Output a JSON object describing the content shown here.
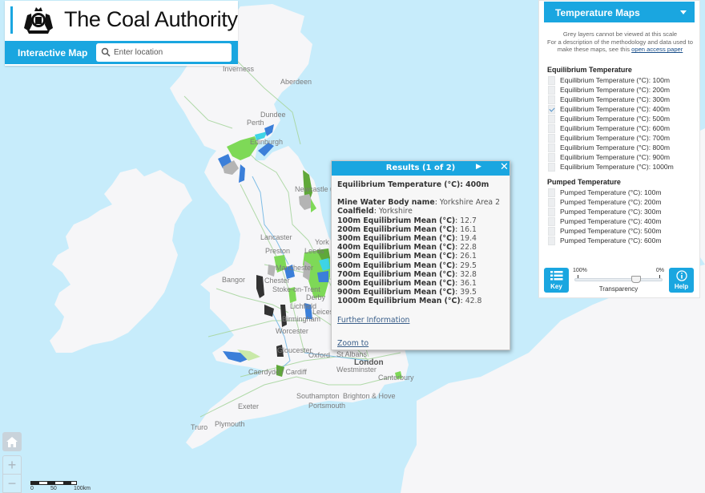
{
  "header": {
    "title": "The Coal Authority",
    "subtitle": "Interactive Map",
    "search_placeholder": "Enter location",
    "search_value": ""
  },
  "map": {
    "places": [
      {
        "name": "Inverness",
        "kind": "minor"
      },
      {
        "name": "Aberdeen",
        "kind": "minor"
      },
      {
        "name": "Dundee",
        "kind": "minor"
      },
      {
        "name": "Perth",
        "kind": "minor"
      },
      {
        "name": "Edinburgh",
        "kind": "minor"
      },
      {
        "name": "Newcastle upon Tyne",
        "kind": "minor"
      },
      {
        "name": "Lancaster",
        "kind": "minor"
      },
      {
        "name": "Preston",
        "kind": "minor"
      },
      {
        "name": "York",
        "kind": "minor"
      },
      {
        "name": "Leeds",
        "kind": "minor"
      },
      {
        "name": "Manchester",
        "kind": "minor"
      },
      {
        "name": "Bangor",
        "kind": "minor"
      },
      {
        "name": "Chester",
        "kind": "minor"
      },
      {
        "name": "Stoke-on-Trent",
        "kind": "minor"
      },
      {
        "name": "Derby",
        "kind": "minor"
      },
      {
        "name": "Lichfield",
        "kind": "minor"
      },
      {
        "name": "Leicester",
        "kind": "minor"
      },
      {
        "name": "Birmingham",
        "kind": "minor"
      },
      {
        "name": "Worcester",
        "kind": "minor"
      },
      {
        "name": "Gloucester",
        "kind": "minor"
      },
      {
        "name": "Oxford",
        "kind": "minor"
      },
      {
        "name": "St Albans",
        "kind": "minor"
      },
      {
        "name": "London",
        "kind": "major"
      },
      {
        "name": "Westminster",
        "kind": "minor"
      },
      {
        "name": "Canterbury",
        "kind": "minor"
      },
      {
        "name": "Caerdydd / Cardiff",
        "kind": "minor"
      },
      {
        "name": "Southampton",
        "kind": "minor"
      },
      {
        "name": "Portsmouth",
        "kind": "minor"
      },
      {
        "name": "Brighton & Hove",
        "kind": "minor"
      },
      {
        "name": "Exeter",
        "kind": "minor"
      },
      {
        "name": "Plymouth",
        "kind": "minor"
      },
      {
        "name": "Truro",
        "kind": "minor"
      }
    ],
    "scale": {
      "labels": [
        "0",
        "50",
        "100km"
      ]
    },
    "controls": {
      "home": "home-icon",
      "zoom_in": "+",
      "zoom_out": "−"
    },
    "colors": {
      "sea": "#c7ecfb",
      "land": "#f6f6f8",
      "road": "#a9d6a0",
      "water_line": "#7fbde6",
      "coal_green": "#7ed957",
      "coal_blue": "#3b7fd9",
      "coal_cyan": "#3ed4e6",
      "coal_grey": "#b4b4b4",
      "coal_dark": "#333333",
      "coal_darkgreen": "#5fa83a"
    }
  },
  "popup": {
    "title": "Results (1 of 2)",
    "layer_title": "Equilibrium Temperature (°C): 400m",
    "fields": [
      {
        "label": "Mine Water Body name",
        "value": "Yorkshire Area 2"
      },
      {
        "label": "Coalfield",
        "value": "Yorkshire"
      },
      {
        "label": "100m Equilibrium Mean (°C)",
        "value": "12.7"
      },
      {
        "label": "200m Equilibrium Mean (°C)",
        "value": "16.1"
      },
      {
        "label": "300m Equilibrium Mean (°C)",
        "value": "19.4"
      },
      {
        "label": "400m Equilibrium Mean (°C)",
        "value": "22.8"
      },
      {
        "label": "500m Equilibrium Mean (°C)",
        "value": "26.1"
      },
      {
        "label": "600m Equilibrium Mean (°C)",
        "value": "29.5"
      },
      {
        "label": "700m Equilibrium Mean (°C)",
        "value": "32.8"
      },
      {
        "label": "800m Equilibrium Mean (°C)",
        "value": "36.1"
      },
      {
        "label": "900m Equilibrium Mean (°C)",
        "value": "39.5"
      },
      {
        "label": "1000m Equilibrium Mean (°C)",
        "value": "42.8"
      }
    ],
    "further_info": "Further Information",
    "zoom_to": "Zoom to",
    "next_icon": "▶",
    "close_icon": "✕"
  },
  "panel": {
    "dropdown_title": "Temperature Maps",
    "note_line1": "Grey layers cannot be viewed at this scale",
    "note_line2": "For a description of the methodology and data used to make these maps, see this",
    "note_link": "open access paper",
    "groups": [
      {
        "title": "Equilibrium Temperature",
        "items": [
          {
            "label": "Equilibrium Temperature (°C): 100m",
            "checked": false
          },
          {
            "label": "Equilibrium Temperature (°C): 200m",
            "checked": false
          },
          {
            "label": "Equilibrium Temperature (°C): 300m",
            "checked": false
          },
          {
            "label": "Equilibrium Temperature (°C): 400m",
            "checked": true
          },
          {
            "label": "Equilibrium Temperature (°C): 500m",
            "checked": false
          },
          {
            "label": "Equilibrium Temperature (°C): 600m",
            "checked": false
          },
          {
            "label": "Equilibrium Temperature (°C): 700m",
            "checked": false
          },
          {
            "label": "Equilibrium Temperature (°C): 800m",
            "checked": false
          },
          {
            "label": "Equilibrium Temperature (°C): 900m",
            "checked": false
          },
          {
            "label": "Equilibrium Temperature (°C): 1000m",
            "checked": false
          }
        ]
      },
      {
        "title": "Pumped Temperature",
        "items": [
          {
            "label": "Pumped Temperature (°C): 100m",
            "checked": false
          },
          {
            "label": "Pumped Temperature (°C): 200m",
            "checked": false
          },
          {
            "label": "Pumped Temperature (°C): 300m",
            "checked": false
          },
          {
            "label": "Pumped Temperature (°C): 400m",
            "checked": false
          },
          {
            "label": "Pumped Temperature (°C): 500m",
            "checked": false
          },
          {
            "label": "Pumped Temperature (°C): 600m",
            "checked": false
          }
        ]
      }
    ],
    "key_label": "Key",
    "help_label": "Help",
    "transparency": {
      "label": "Transparency",
      "min_label": "100%",
      "max_label": "0%",
      "value_fraction": 0.7
    },
    "accent": "#1aa6e0"
  }
}
